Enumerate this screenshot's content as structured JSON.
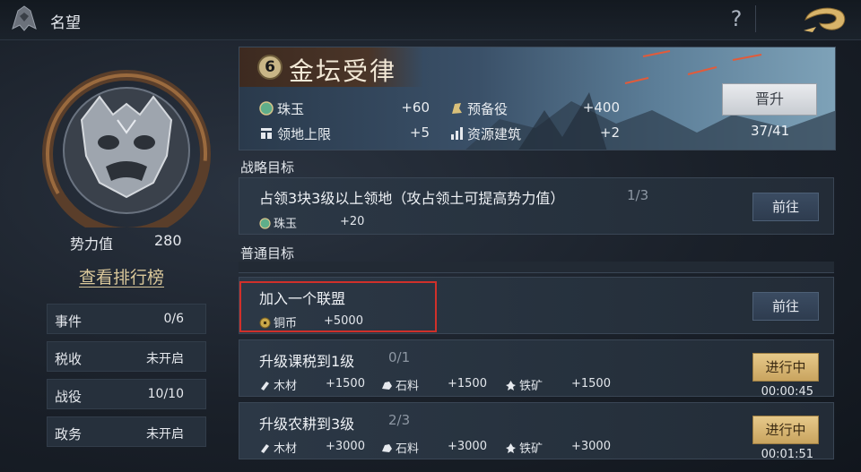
{
  "header": {
    "title": "名望",
    "help_icon": "question-mark-icon",
    "back_icon": "dragon-back-icon"
  },
  "left_panel": {
    "emblem_icon": "demon-mask-emblem-icon",
    "power_label": "势力值",
    "power_value": "280",
    "ranking_link": "查看排行榜",
    "stats": [
      {
        "label": "事件",
        "value": "0/6"
      },
      {
        "label": "税收",
        "value": "未开启"
      },
      {
        "label": "战役",
        "value": "10/10"
      },
      {
        "label": "政务",
        "value": "未开启"
      }
    ]
  },
  "banner": {
    "level": "6",
    "title": "金坛受律",
    "resources": [
      {
        "label": "珠玉",
        "value": "+60",
        "icon": "jade-orb-icon"
      },
      {
        "label": "预备役",
        "value": "+400",
        "icon": "reserve-soldier-icon"
      },
      {
        "label": "领地上限",
        "value": "+5",
        "icon": "territory-limit-icon"
      },
      {
        "label": "资源建筑",
        "value": "+2",
        "icon": "resource-building-icon"
      }
    ],
    "promote_label": "晋升",
    "progress": "37/41"
  },
  "strategic": {
    "label": "战略目标",
    "task": {
      "name": "占领3块3级以上领地（攻占领土可提高势力值）",
      "progress": "1/3",
      "reward_label": "珠玉",
      "reward_value": "+20",
      "button": "前往"
    }
  },
  "normal": {
    "label": "普通目标",
    "tasks": [
      {
        "name": "加入一个联盟",
        "progress": "",
        "rewards": [
          {
            "label": "铜币",
            "value": "+5000",
            "icon": "copper-coin-icon"
          }
        ],
        "button": "前往",
        "timer": ""
      },
      {
        "name": "升级课税到1级",
        "progress": "0/1",
        "rewards": [
          {
            "label": "木材",
            "value": "+1500",
            "icon": "wood-icon"
          },
          {
            "label": "石料",
            "value": "+1500",
            "icon": "stone-icon"
          },
          {
            "label": "铁矿",
            "value": "+1500",
            "icon": "iron-ore-icon"
          }
        ],
        "button": "进行中",
        "timer": "00:00:45"
      },
      {
        "name": "升级农耕到3级",
        "progress": "2/3",
        "rewards": [
          {
            "label": "木材",
            "value": "+3000",
            "icon": "wood-icon"
          },
          {
            "label": "石料",
            "value": "+3000",
            "icon": "stone-icon"
          },
          {
            "label": "铁矿",
            "value": "+3000",
            "icon": "iron-ore-icon"
          }
        ],
        "button": "进行中",
        "timer": "00:01:51"
      }
    ]
  },
  "colors": {
    "accent_gold": "#c9a45f",
    "highlight_red": "#d0302a",
    "banner_title": "#f2e8d6"
  }
}
